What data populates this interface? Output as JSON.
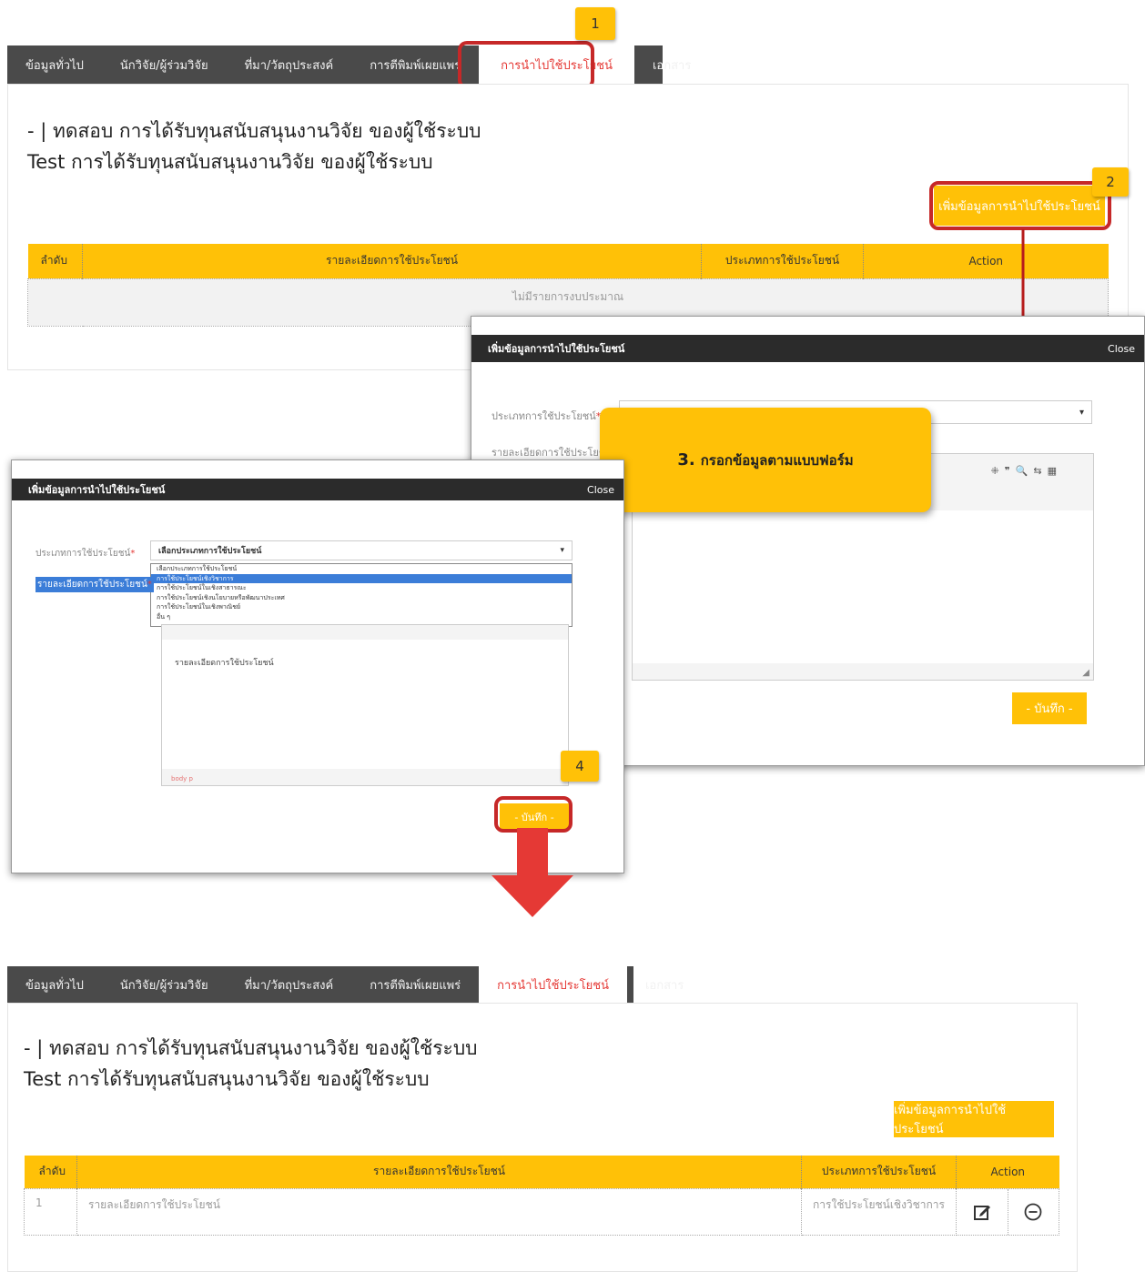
{
  "markers": {
    "m1": "1",
    "m2": "2",
    "m4": "4"
  },
  "tabs": [
    "ข้อมูลทั่วไป",
    "นักวิจัย/ผู้ร่วมวิจัย",
    "ที่มา/วัตถุประสงค์",
    "การตีพิมพ์เผยแพร่",
    "การนำไปใช้ประโยชน์",
    "เอกสาร"
  ],
  "project": {
    "title_th": "- | ทดสอบ การได้รับทุนสนับสนุนงานวิจัย ของผู้ใช้ระบบ",
    "title_en": "Test การได้รับทุนสนับสนุนงานวิจัย ของผู้ใช้ระบบ"
  },
  "add_button_label": "เพิ่มข้อมูลการนำไปใช้ประโยชน์",
  "table": {
    "headers": [
      "ลำดับ",
      "รายละเอียดการใช้ประโยชน์",
      "ประเภทการใช้ประโยชน์",
      "Action"
    ],
    "empty_text": "ไม่มีรายการงบประมาณ",
    "row": {
      "no": "1",
      "detail": "รายละเอียดการใช้ประโยชน์",
      "type": "การใช้ประโยชน์เชิงวิชาการ"
    }
  },
  "modal": {
    "title": "เพิ่มข้อมูลการนำไปใช้ประโยชน์",
    "close": "Close",
    "type_label": "ประเภทการใช้ประโยชน์",
    "detail_label": "รายละเอียดการใช้ประโยชน์",
    "required_mark": "*",
    "save": "- บันทึก -",
    "select_placeholder": "เลือกประเภทการใช้ประโยชน์",
    "options": [
      "เลือกประเภทการใช้ประโยชน์",
      "การใช้ประโยชน์เชิงวิชาการ",
      "การใช้ประโยชน์ในเชิงสาธารณะ",
      "การใช้ประโยชน์เชิงนโยบายหรือพัฒนาประเทศ",
      "การใช้ประโยชน์ในเชิงพาณิชย์",
      "อื่น ๆ"
    ],
    "editor_text": "รายละเอียดการใช้ประโยชน์",
    "editor_status": "body p"
  },
  "callout": {
    "num": "3.",
    "text": "กรอกข้อมูลตามแบบฟอร์ม"
  },
  "colors": {
    "accent": "#ffc107",
    "highlight": "#c62828",
    "dark": "#4a4a4a"
  }
}
